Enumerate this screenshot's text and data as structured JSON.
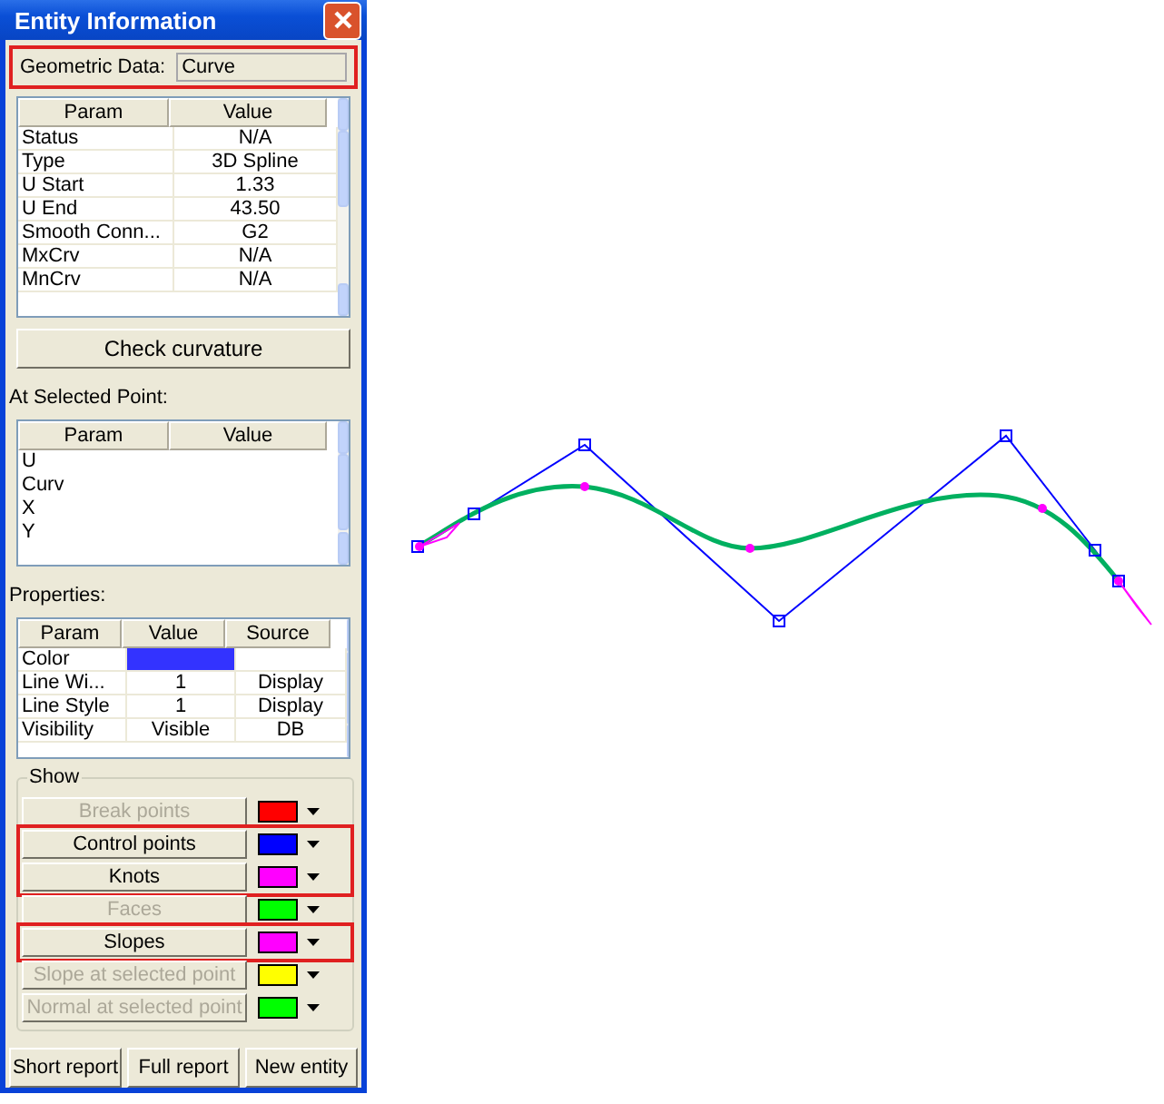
{
  "window": {
    "title": "Entity Information"
  },
  "geometric_data": {
    "label": "Geometric Data:",
    "value": "Curve",
    "highlighted": true
  },
  "entity_table": {
    "columns": [
      "Param",
      "Value"
    ],
    "rows": [
      [
        "Status",
        "N/A"
      ],
      [
        "Type",
        "3D Spline"
      ],
      [
        "U Start",
        "1.33"
      ],
      [
        "U End",
        "43.50"
      ],
      [
        "Smooth Conn...",
        "G2"
      ],
      [
        "MxCrv",
        "N/A"
      ],
      [
        "MnCrv",
        "N/A"
      ]
    ]
  },
  "check_button": "Check curvature",
  "selected_point": {
    "label": "At Selected Point:",
    "columns": [
      "Param",
      "Value"
    ],
    "rows": [
      [
        "U",
        ""
      ],
      [
        "Curv",
        ""
      ],
      [
        "X",
        ""
      ],
      [
        "Y",
        ""
      ]
    ]
  },
  "properties": {
    "label": "Properties:",
    "columns": [
      "Param",
      "Value",
      "Source"
    ],
    "rows": [
      {
        "kind": "swatch",
        "param": "Color",
        "color": "#3333ff",
        "source": ""
      },
      {
        "kind": "text",
        "param": "Line Wi...",
        "value": "1",
        "source": "Display"
      },
      {
        "kind": "text",
        "param": "Line Style",
        "value": "1",
        "source": "Display"
      },
      {
        "kind": "text",
        "param": "Visibility",
        "value": "Visible",
        "source": "DB"
      }
    ]
  },
  "show": {
    "label": "Show",
    "items": [
      {
        "label": "Break points",
        "enabled": false,
        "highlighted": false,
        "color": "#ff0000"
      },
      {
        "label": "Control points",
        "enabled": true,
        "highlighted": true,
        "color": "#0000ff"
      },
      {
        "label": "Knots",
        "enabled": true,
        "highlighted": true,
        "color": "#ff00ff"
      },
      {
        "label": "Faces",
        "enabled": false,
        "highlighted": false,
        "color": "#00ff00"
      },
      {
        "label": "Slopes",
        "enabled": true,
        "highlighted": true,
        "color": "#ff00ff"
      },
      {
        "label": "Slope at selected point",
        "enabled": false,
        "highlighted": false,
        "color": "#ffff00"
      },
      {
        "label": "Normal at selected point",
        "enabled": false,
        "highlighted": false,
        "color": "#00ff00"
      }
    ]
  },
  "buttons": [
    "Short report",
    "Full report",
    "New entity"
  ]
}
